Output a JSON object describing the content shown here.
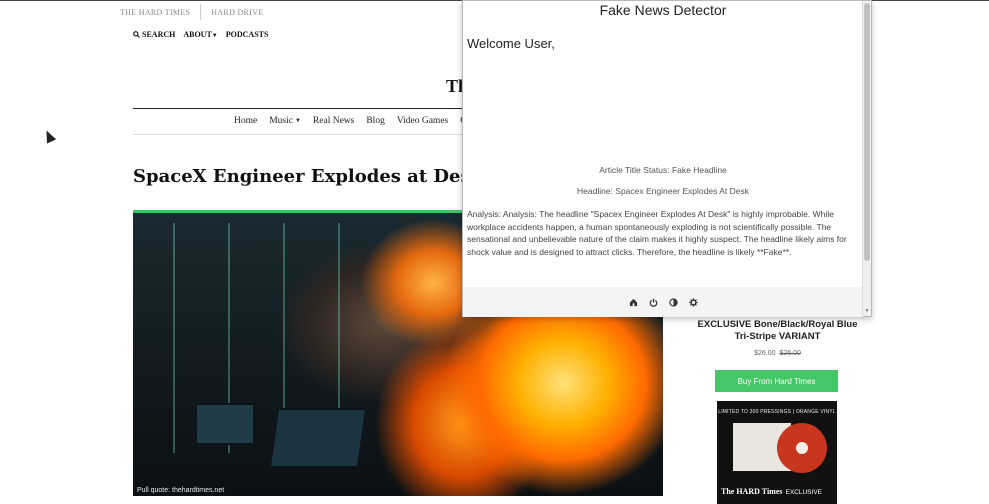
{
  "site": {
    "top_links": [
      "THE HARD TIMES",
      "HARD DRIVE"
    ],
    "utility": {
      "search_label": "SEARCH",
      "about_label": "ABOUT",
      "podcasts_label": "PODCASTS"
    },
    "logo_text": "Th",
    "nav": [
      "Home",
      "Music",
      "Real News",
      "Blog",
      "Video Games",
      "O"
    ],
    "article_title": "SpaceX Engineer Explodes at Desk",
    "image_credit": "Pull quote: thehardtimes.net",
    "product": {
      "title": "EXCLUSIVE Bone/Black/Royal Blue Tri-Stripe VARIANT",
      "price": "$26.00",
      "old_price": "$26.00",
      "buy_label": "Buy From Hard Times",
      "vinyl_banner": "LIMITED TO 300 PRESSINGS | ORANGE VINYL",
      "vinyl_brand": "The HARD Times",
      "vinyl_tag": "EXCLUSIVE"
    }
  },
  "popup": {
    "title": "Fake News Detector",
    "welcome": "Welcome User,",
    "status_line": "Article Title Status: Fake Headline",
    "headline_line": "Headline: Spacex Engineer Explodes At Desk",
    "analysis": "Analysis: Analysis: The headline \"Spacex Engineer Explodes At Desk\" is highly improbable. While workplace accidents happen, a human spontaneously exploding is not scientifically possible. The sensational and unbelievable nature of the claim makes it highly suspect. The headline likely aims for shock value and is designed to attract clicks. Therefore, the headline is likely **Fake**.",
    "footer_icons": [
      "home-icon",
      "power-icon",
      "contrast-icon",
      "gear-icon"
    ]
  },
  "colors": {
    "accent_green": "#44c767",
    "hero_border": "#3cc464"
  }
}
